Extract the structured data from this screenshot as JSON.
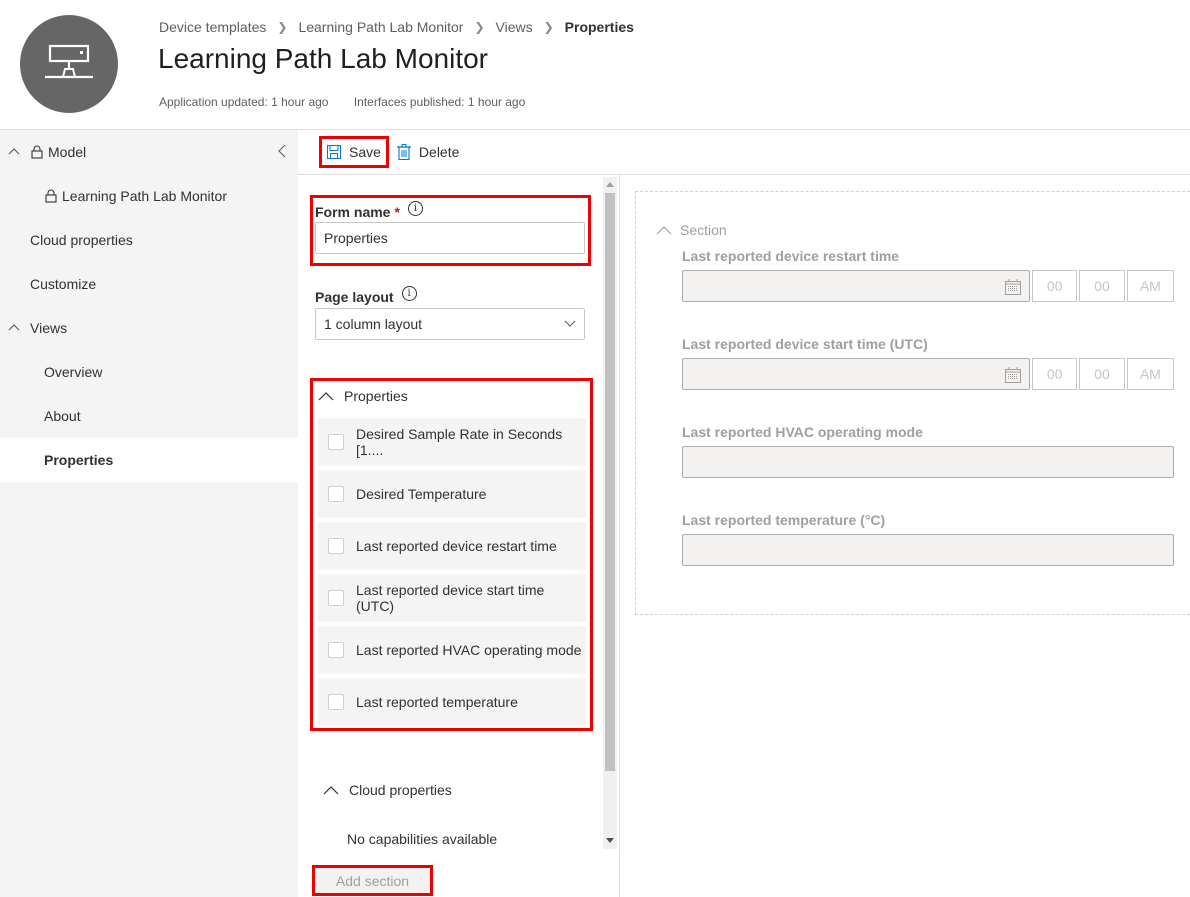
{
  "header": {
    "breadcrumb": [
      "Device templates",
      "Learning Path Lab Monitor",
      "Views",
      "Properties"
    ],
    "title": "Learning Path Lab Monitor",
    "app_updated": "Application updated: 1 hour ago",
    "interfaces_published": "Interfaces published: 1 hour ago",
    "avatar_icon": "device-network-icon"
  },
  "sidebar": {
    "items": [
      {
        "label": "Model",
        "expanded": true,
        "locked": true
      },
      {
        "label": "Learning Path Lab Monitor",
        "locked": true
      },
      {
        "label": "Cloud properties"
      },
      {
        "label": "Customize"
      },
      {
        "label": "Views",
        "expanded": true
      },
      {
        "label": "Overview"
      },
      {
        "label": "About"
      },
      {
        "label": "Properties",
        "active": true
      }
    ]
  },
  "toolbar": {
    "save_label": "Save",
    "delete_label": "Delete"
  },
  "editor": {
    "form_name_label": "Form name",
    "form_name_required": "*",
    "form_name_value": "Properties",
    "page_layout_label": "Page layout",
    "page_layout_value": "1 column layout",
    "properties_group": {
      "title": "Properties",
      "items": [
        "Desired Sample Rate in Seconds [1....",
        "Desired Temperature",
        "Last reported device restart time",
        "Last reported device start time (UTC)",
        "Last reported HVAC operating mode",
        "Last reported temperature"
      ]
    },
    "cloud_group": {
      "title": "Cloud properties",
      "empty_text": "No capabilities available"
    },
    "add_section_label": "Add section"
  },
  "preview": {
    "section_title": "Section",
    "fields": [
      {
        "label": "Last reported device restart time",
        "type": "datetime",
        "hour": "00",
        "minute": "00",
        "ampm": "AM"
      },
      {
        "label": "Last reported device start time (UTC)",
        "type": "datetime",
        "hour": "00",
        "minute": "00",
        "ampm": "AM"
      },
      {
        "label": "Last reported HVAC operating mode",
        "type": "text"
      },
      {
        "label": "Last reported temperature (°C)",
        "type": "text"
      }
    ]
  },
  "colors": {
    "highlight": "#ee0000",
    "avatar_bg": "#666666",
    "save_icon": "#0078d4"
  }
}
